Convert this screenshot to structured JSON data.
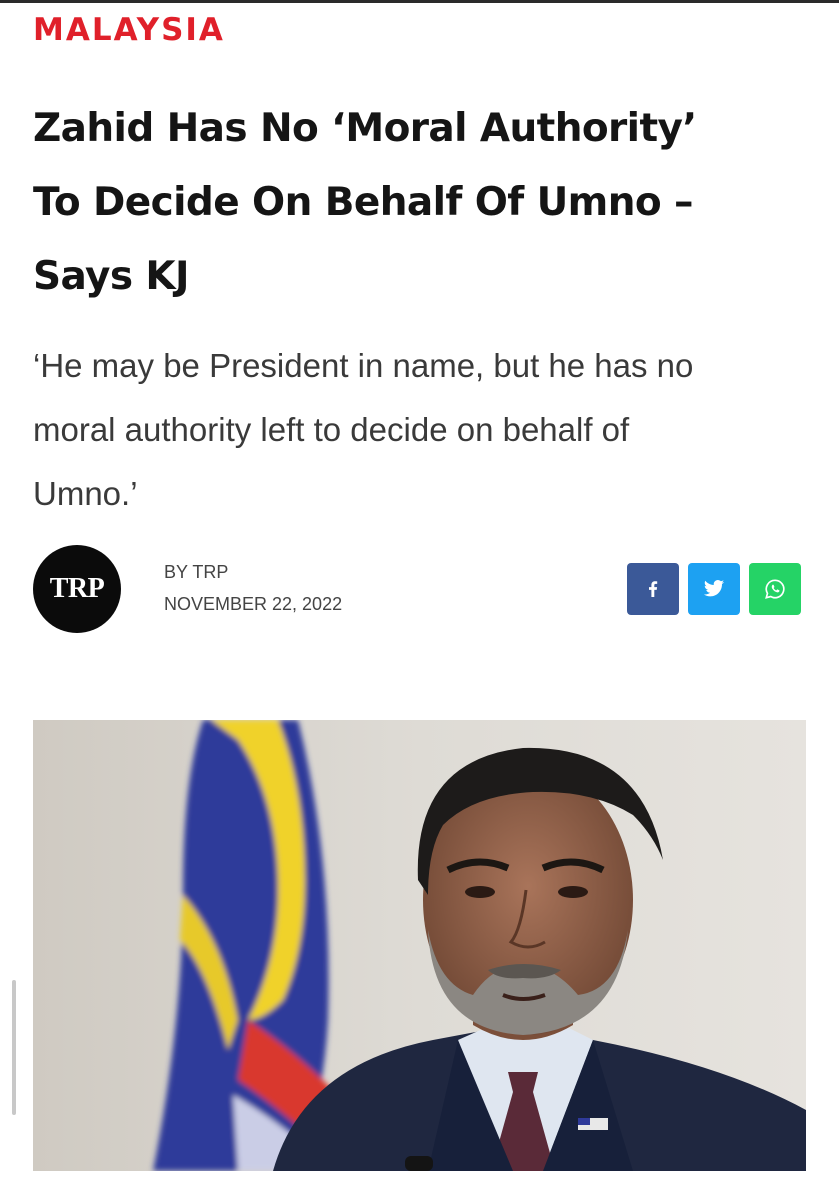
{
  "article": {
    "category": "MALAYSIA",
    "headline": {
      "line1": "Zahid Has No ‘Moral Authority’",
      "line2": "To Decide On Behalf Of Umno –",
      "line3": "Says KJ"
    },
    "standfirst": {
      "line1": "‘He may be President in name, but he has no",
      "line2": "moral authority left to decide on behalf of",
      "line3": "Umno.’"
    },
    "author": {
      "logo_text": "TRP",
      "byline": "BY TRP",
      "date": "NOVEMBER 22, 2022"
    },
    "share": [
      {
        "icon": "facebook-icon",
        "glyph": "f",
        "color": "#3b5998"
      },
      {
        "icon": "twitter-icon",
        "glyph": "🐦",
        "color": "#1da1f2"
      },
      {
        "icon": "whatsapp-icon",
        "glyph": "✆",
        "color": "#25d366"
      }
    ],
    "hero_image": {
      "depicts": "man-with-malaysian-flag"
    }
  },
  "colors": {
    "accent": "#e0202a",
    "headline": "#151515",
    "body": "#3a3a3a"
  }
}
